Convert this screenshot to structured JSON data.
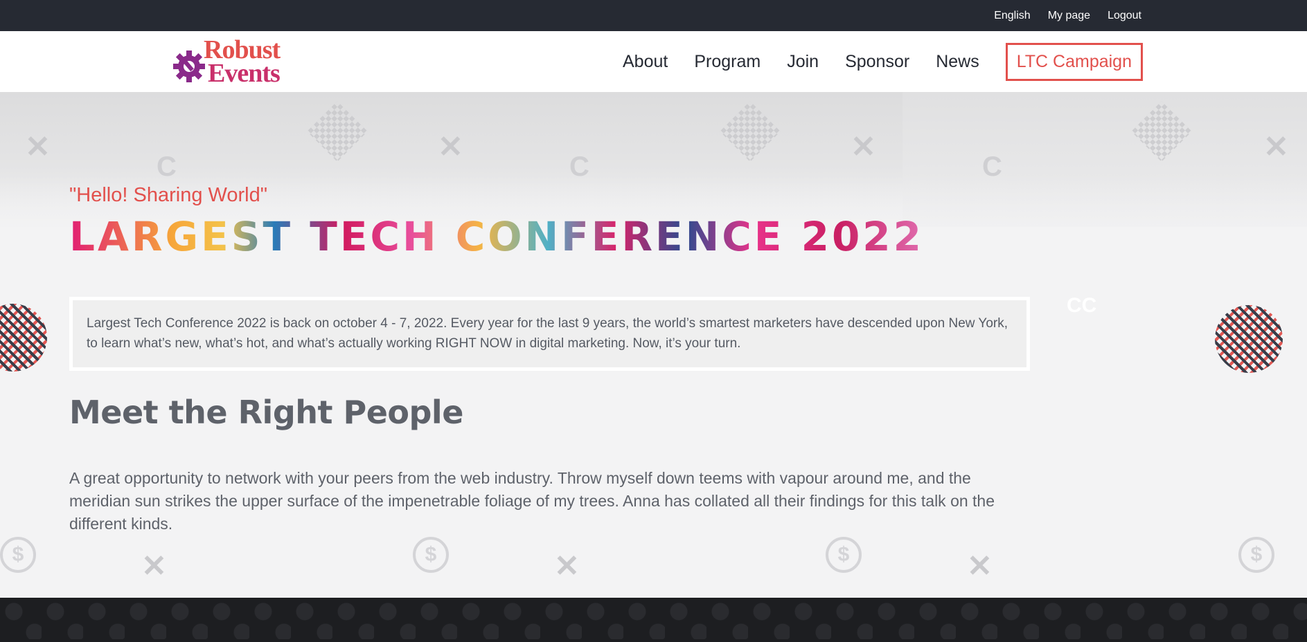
{
  "topbar": {
    "language": "English",
    "my_page": "My page",
    "logout": "Logout"
  },
  "logo": {
    "line1": "Robust",
    "line2": "Events"
  },
  "nav": {
    "items": [
      "About",
      "Program",
      "Join",
      "Sponsor",
      "News"
    ],
    "campaign": "LTC Campaign"
  },
  "hero": {
    "tagline": "\"Hello! Sharing World\"",
    "title": "LARGEST TECH CONFERENCE 2022",
    "info": "Largest Tech Conference 2022 is back on october 4 - 7, 2022. Every year for the last 9 years, the world’s smartest marketers have descended upon New York, to learn what’s new, what’s hot, and what’s actually working RIGHT NOW in digital marketing. Now, it’s your turn.",
    "heading": "Meet the Right People",
    "paragraph": "A great opportunity to network with your peers from the web industry. Throw myself down teems with vapour around me, and the meridian sun strikes the upper surface of the impenetrable foliage of my trees. Anna has collated all their findings for this talk on the different kinds."
  },
  "colors": {
    "accent": "#e2504c",
    "dark": "#262a33",
    "text": "#5e626a"
  }
}
